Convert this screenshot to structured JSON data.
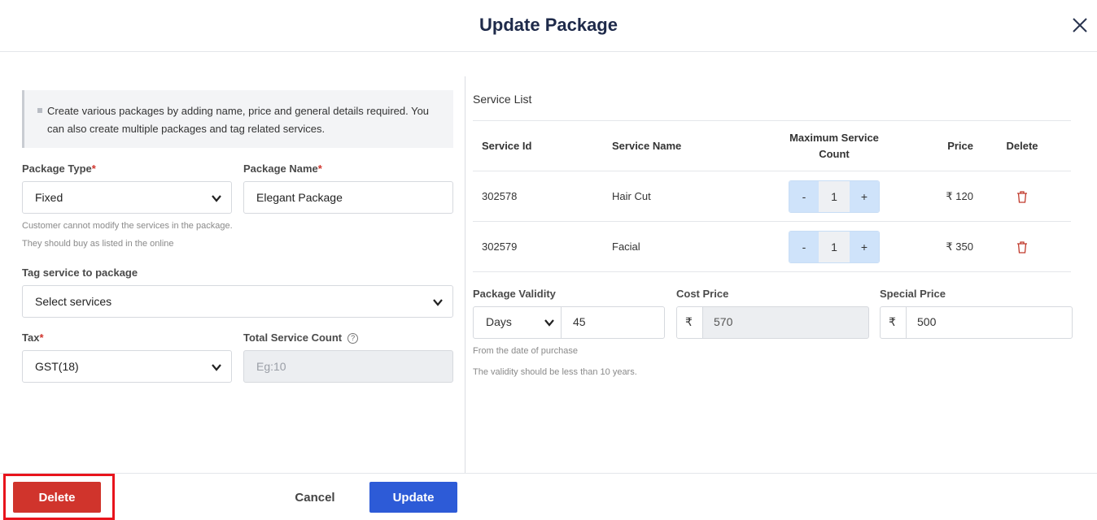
{
  "header": {
    "title": "Update Package"
  },
  "info_text": "Create various packages by adding name, price and general details required. You can also create multiple packages and tag related services.",
  "form": {
    "package_type": {
      "label": "Package Type",
      "required": "*",
      "value": "Fixed",
      "hint1": "Customer cannot modify the services in the package.",
      "hint2": "They should buy as listed in the online"
    },
    "package_name": {
      "label": "Package Name",
      "required": "*",
      "value": "Elegant Package"
    },
    "tag_service": {
      "label": "Tag service to package",
      "value": "Select services"
    },
    "tax": {
      "label": "Tax",
      "required": "*",
      "value": "GST(18)"
    },
    "total_service_count": {
      "label": "Total Service Count",
      "help": "?",
      "placeholder": "Eg:10"
    }
  },
  "service_list": {
    "title": "Service List",
    "columns": [
      "Service Id",
      "Service Name",
      "Maximum Service Count",
      "Price",
      "Delete"
    ],
    "rows": [
      {
        "id": "302578",
        "name": "Hair Cut",
        "count": "1",
        "price": "₹ 120"
      },
      {
        "id": "302579",
        "name": "Facial",
        "count": "1",
        "price": "₹ 350"
      }
    ],
    "minus": "-",
    "plus": "+"
  },
  "validity": {
    "label": "Package Validity",
    "unit": "Days",
    "value": "45",
    "hint1": "From the date of purchase",
    "hint2": "The validity should be less than 10 years."
  },
  "cost_price": {
    "label": "Cost Price",
    "currency": "₹",
    "value": "570"
  },
  "special_price": {
    "label": "Special Price",
    "currency": "₹",
    "value": "500"
  },
  "footer": {
    "delete": "Delete",
    "cancel": "Cancel",
    "update": "Update"
  },
  "colors": {
    "primary": "#2d5bd7",
    "danger": "#d0342c",
    "highlight": "#e8141c",
    "stepper": "#cfe3fa"
  },
  "icons": {
    "close": "close-icon",
    "chevron": "chevron-down-icon",
    "trash": "trash-icon",
    "help": "help-icon"
  }
}
